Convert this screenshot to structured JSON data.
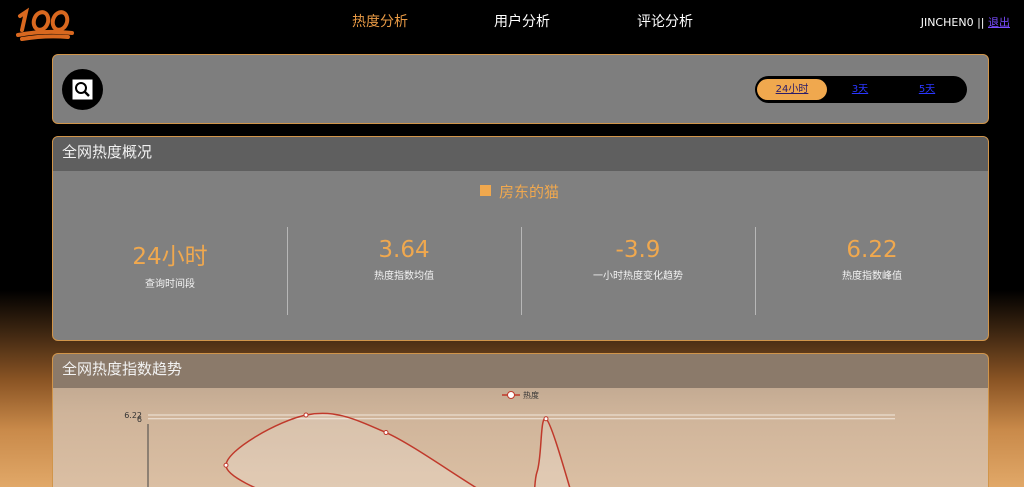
{
  "nav": {
    "logo_text": "100",
    "items": [
      {
        "label": "热度分析",
        "active": true
      },
      {
        "label": "用户分析",
        "active": false
      },
      {
        "label": "评论分析",
        "active": false
      }
    ],
    "username": "JINCHEN0",
    "separator": "||",
    "logout": "退出"
  },
  "search": {
    "icon": "search-icon",
    "ranges": [
      {
        "label": "24小时",
        "active": true
      },
      {
        "label": "3天",
        "active": false
      },
      {
        "label": "5天",
        "active": false
      }
    ]
  },
  "overview": {
    "title": "全网热度概况",
    "keyword": "房东的猫",
    "stats": [
      {
        "value": "24小时",
        "label": "查询时间段"
      },
      {
        "value": "3.64",
        "label": "热度指数均值"
      },
      {
        "value": "-3.9",
        "label": "一小时热度变化趋势"
      },
      {
        "value": "6.22",
        "label": "热度指数峰值"
      }
    ]
  },
  "trend": {
    "title": "全网热度指数趋势"
  },
  "chart_data": {
    "type": "line",
    "series": [
      {
        "name": "热度",
        "color": "#c0392b",
        "points": [
          {
            "x": 3,
            "y": 3.3
          },
          {
            "x": 4,
            "y": 6.22
          },
          {
            "x": 5,
            "y": 5.2
          },
          {
            "x": 7,
            "y": 6.0
          }
        ]
      }
    ],
    "y_ticks": [
      "6.22",
      "6"
    ],
    "grid": true,
    "legend": "top-center"
  },
  "colors": {
    "accent": "#f0a84e",
    "active_nav": "#e89a45",
    "link": "#2a36ff"
  }
}
